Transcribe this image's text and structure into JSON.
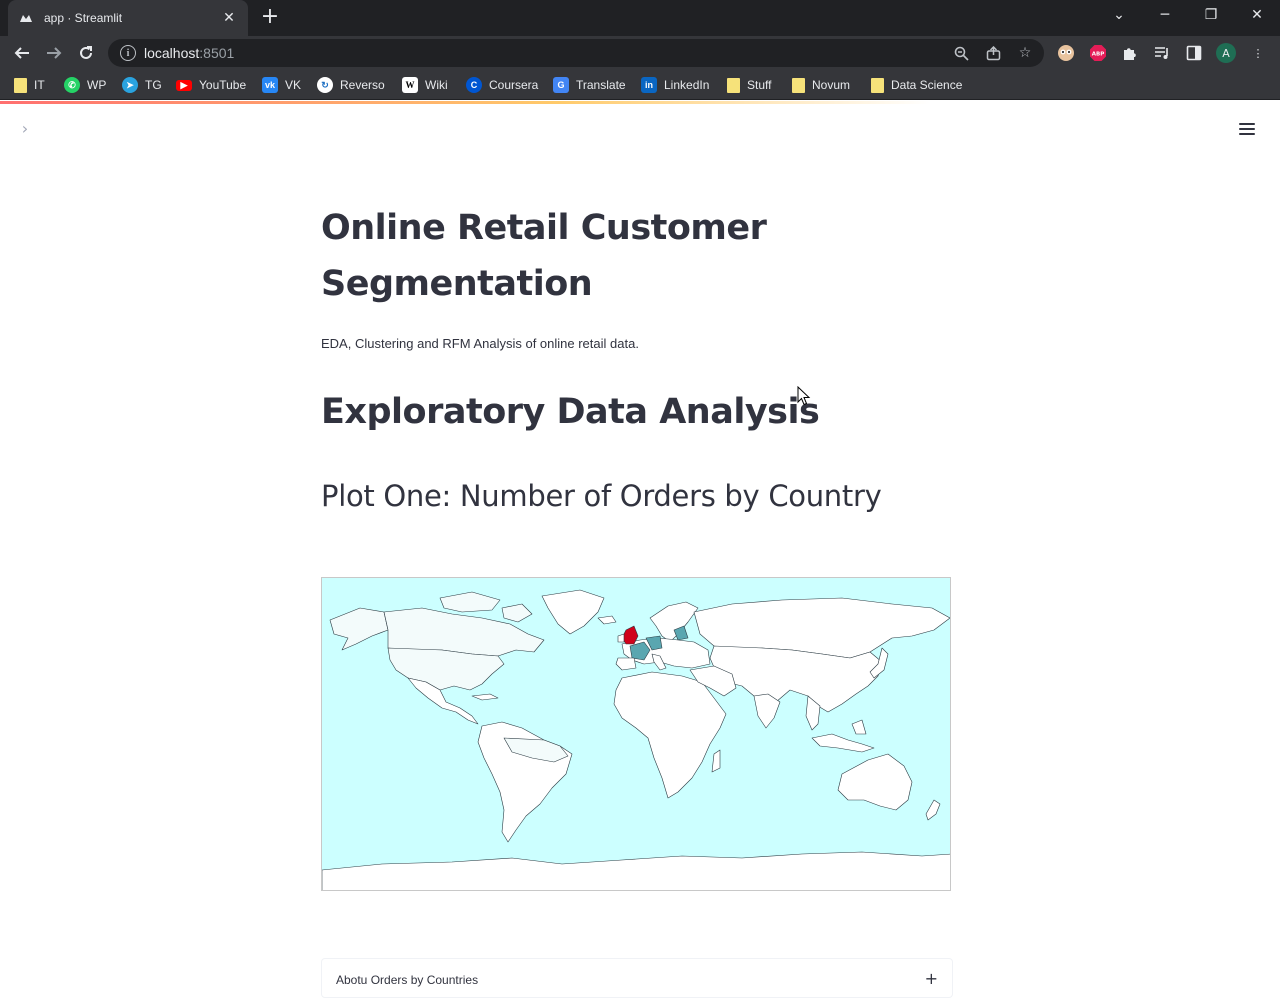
{
  "browser": {
    "tab_title": "app · Streamlit",
    "url_host": "localhost",
    "url_port": ":8501",
    "profile_initial": "A",
    "bookmarks": [
      "IT",
      "WP",
      "TG",
      "YouTube",
      "VK",
      "Reverso",
      "Wiki",
      "Coursera",
      "Translate",
      "LinkedIn",
      "Stuff",
      "Novum",
      "Data Science"
    ]
  },
  "app": {
    "title": "Online Retail Customer Segmentation",
    "caption": "EDA, Clustering and RFM Analysis of online retail data.",
    "section_heading": "Exploratory Data Analysis",
    "subheading": "Plot One: Number of Orders by Country",
    "expander_label": "Abotu Orders by Countries",
    "expander_icon": "+"
  },
  "map": {
    "ocean_color": "#ccffff",
    "land_color": "#ffffff",
    "highlight_colors": {
      "United Kingdom": "#d0021b",
      "Europe": "#5aa6b0",
      "Americas": "#f3fbfb"
    }
  }
}
